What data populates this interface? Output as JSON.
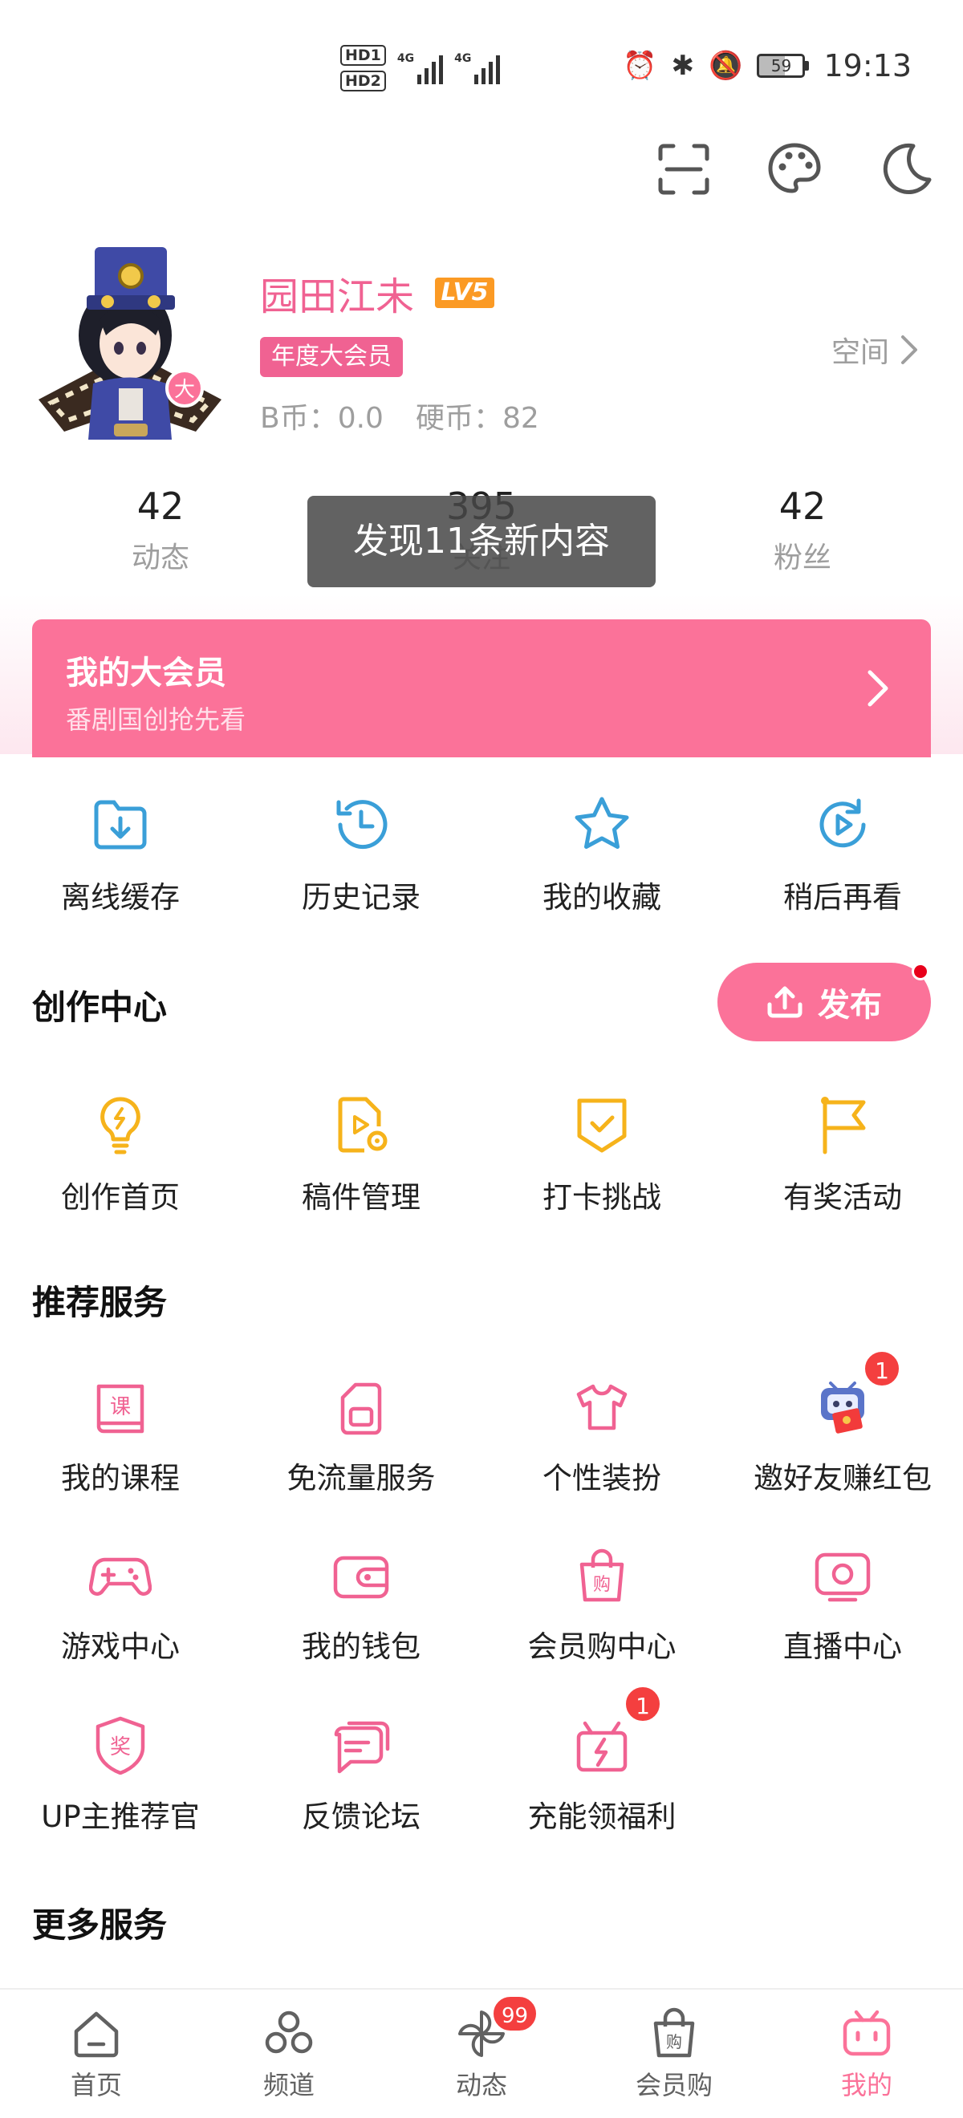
{
  "status_bar": {
    "sim1": "HD1",
    "sim2": "HD2",
    "net1": "4G",
    "net2": "4G",
    "battery": "59",
    "time": "19:13"
  },
  "profile": {
    "username": "园田江未",
    "level_badge": "LV5",
    "vip_badge": "年度大会员",
    "space_link": "空间",
    "b_coin": "B币：0.0",
    "coins": "硬币：82"
  },
  "stats": [
    {
      "value": "42",
      "label": "动态"
    },
    {
      "value": "395",
      "label": "关注"
    },
    {
      "value": "42",
      "label": "粉丝"
    }
  ],
  "toast": "发现11条新内容",
  "vip_banner": {
    "title": "我的大会员",
    "subtitle": "番剧国创抢先看"
  },
  "quick_actions": [
    {
      "label": "离线缓存",
      "icon": "download-folder-icon"
    },
    {
      "label": "历史记录",
      "icon": "history-clock-icon"
    },
    {
      "label": "我的收藏",
      "icon": "star-icon"
    },
    {
      "label": "稍后再看",
      "icon": "watch-later-icon"
    }
  ],
  "creation_center": {
    "title": "创作中心",
    "publish_label": "发布",
    "items": [
      {
        "label": "创作首页",
        "icon": "lightbulb-icon"
      },
      {
        "label": "稿件管理",
        "icon": "video-file-icon"
      },
      {
        "label": "打卡挑战",
        "icon": "check-shield-icon"
      },
      {
        "label": "有奖活动",
        "icon": "flag-icon"
      }
    ]
  },
  "recommended": {
    "title": "推荐服务",
    "items": [
      {
        "label": "我的课程",
        "icon": "course-book-icon",
        "badge": ""
      },
      {
        "label": "免流量服务",
        "icon": "sim-card-icon",
        "badge": ""
      },
      {
        "label": "个性装扮",
        "icon": "tshirt-icon",
        "badge": ""
      },
      {
        "label": "邀好友赚红包",
        "icon": "mascot-red-envelope-icon",
        "badge": "1"
      },
      {
        "label": "游戏中心",
        "icon": "gamepad-icon",
        "badge": ""
      },
      {
        "label": "我的钱包",
        "icon": "wallet-icon",
        "badge": ""
      },
      {
        "label": "会员购中心",
        "icon": "shopping-bag-icon",
        "badge": ""
      },
      {
        "label": "直播中心",
        "icon": "live-tv-icon",
        "badge": ""
      },
      {
        "label": "UP主推荐官",
        "icon": "award-shield-icon",
        "badge": ""
      },
      {
        "label": "反馈论坛",
        "icon": "chat-bubbles-icon",
        "badge": ""
      },
      {
        "label": "充能领福利",
        "icon": "gift-bolt-icon",
        "badge": "1"
      }
    ]
  },
  "more_services": {
    "title": "更多服务"
  },
  "bottom_nav": [
    {
      "label": "首页",
      "icon": "home-icon",
      "badge": ""
    },
    {
      "label": "频道",
      "icon": "channels-icon",
      "badge": ""
    },
    {
      "label": "动态",
      "icon": "pinwheel-icon",
      "badge": "99"
    },
    {
      "label": "会员购",
      "icon": "shopping-bag-icon",
      "badge": ""
    },
    {
      "label": "我的",
      "icon": "tv-mascot-icon",
      "badge": ""
    }
  ],
  "colors": {
    "accent": "#fb7299",
    "username": "#f06292",
    "creation_icon": "#f6b31b",
    "quick_icon": "#3a9fd8",
    "badge": "#f43f3f"
  }
}
